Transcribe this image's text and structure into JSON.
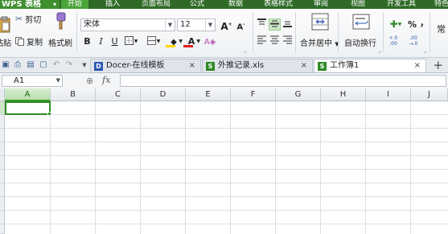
{
  "app": {
    "title": "WPS 表格",
    "caret": "▾"
  },
  "menu": {
    "tabs": [
      {
        "label": "开始",
        "active": true
      },
      {
        "label": "插入"
      },
      {
        "label": "页面布局"
      },
      {
        "label": "公式"
      },
      {
        "label": "数据"
      },
      {
        "label": "表格样式"
      },
      {
        "label": "审阅"
      },
      {
        "label": "视图"
      },
      {
        "label": "开发工具"
      },
      {
        "label": "特色"
      }
    ]
  },
  "ribbon": {
    "paste_label": "粘贴",
    "cut_label": "剪切",
    "copy_label": "复制",
    "format_painter_label": "格式刷",
    "font_name": "宋体",
    "font_size": "12",
    "bold": "B",
    "italic": "I",
    "underline": "U",
    "grow_font": "A",
    "shrink_font": "A",
    "merge_center_label": "合并居中",
    "wrap_text_label": "自动换行",
    "percent": "%",
    "comma": "，",
    "increase_decimal": "+.0 .00",
    "decrease_decimal": ".00 →.0",
    "number_format_initial": "常",
    "colors": {
      "fill_bar": "#ffd700",
      "font_bar": "#e02020"
    }
  },
  "doc_tabs": {
    "tabs": [
      {
        "label": "Docer-在线模板",
        "icon": "D",
        "icon_color": "#2a58b3",
        "close": "×"
      },
      {
        "label": "外推记录.xls",
        "icon": "S",
        "icon_color": "#2f8a25",
        "close": "×"
      },
      {
        "label": "工作簿1",
        "icon": "S",
        "icon_color": "#2f8a25",
        "close": "×",
        "active": true
      }
    ],
    "add": "+"
  },
  "formula_bar": {
    "cell_ref": "A1",
    "fx_label": "fx",
    "value": ""
  },
  "grid": {
    "columns": [
      "A",
      "B",
      "C",
      "D",
      "E",
      "F",
      "G",
      "H",
      "I",
      "J"
    ],
    "selected_column": "A",
    "active_cell": "A1"
  }
}
